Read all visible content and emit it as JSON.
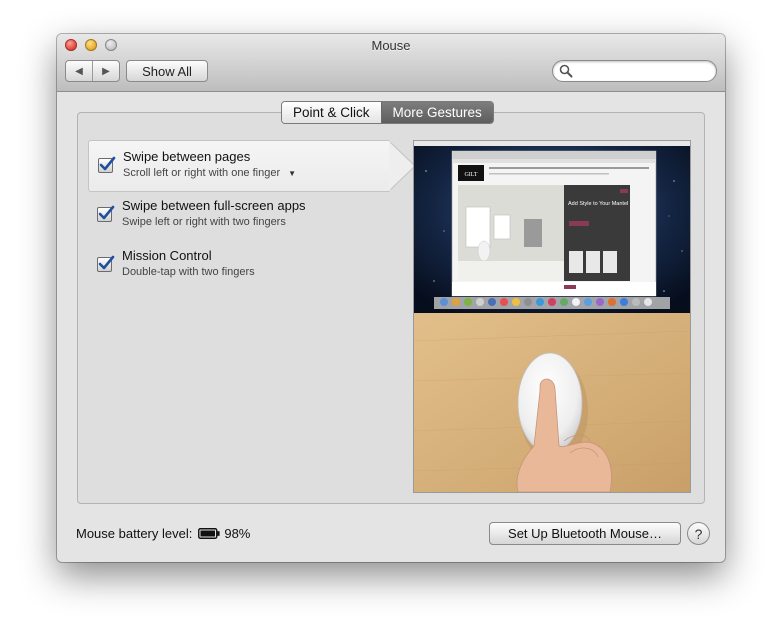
{
  "window": {
    "title": "Mouse"
  },
  "toolbar": {
    "back_glyph": "◀",
    "forward_glyph": "▶",
    "show_all_label": "Show All",
    "search": {
      "value": "",
      "placeholder": ""
    }
  },
  "tabs": [
    {
      "label": "Point & Click",
      "selected": false
    },
    {
      "label": "More Gestures",
      "selected": true
    }
  ],
  "gestures": [
    {
      "title": "Swipe between pages",
      "subtitle": "Scroll left or right with one finger",
      "checked": true,
      "has_popup": true,
      "selected": true
    },
    {
      "title": "Swipe between full-screen apps",
      "subtitle": "Swipe left or right with two fingers",
      "checked": true,
      "has_popup": false,
      "selected": false
    },
    {
      "title": "Mission Control",
      "subtitle": "Double-tap with two fingers",
      "checked": true,
      "has_popup": false,
      "selected": false
    }
  ],
  "preview": {
    "site_logo": "GILT",
    "headline": "Add Style to Your Mantel"
  },
  "footer": {
    "battery_label": "Mouse battery level:",
    "battery_percent": "98%",
    "bluetooth_button": "Set Up Bluetooth Mouse…",
    "help_glyph": "?"
  },
  "colors": {
    "checkbox_check": "#1f4f9e",
    "tab_active_bg": "#6e6e6e",
    "desk_wood": "#d9b37c"
  }
}
